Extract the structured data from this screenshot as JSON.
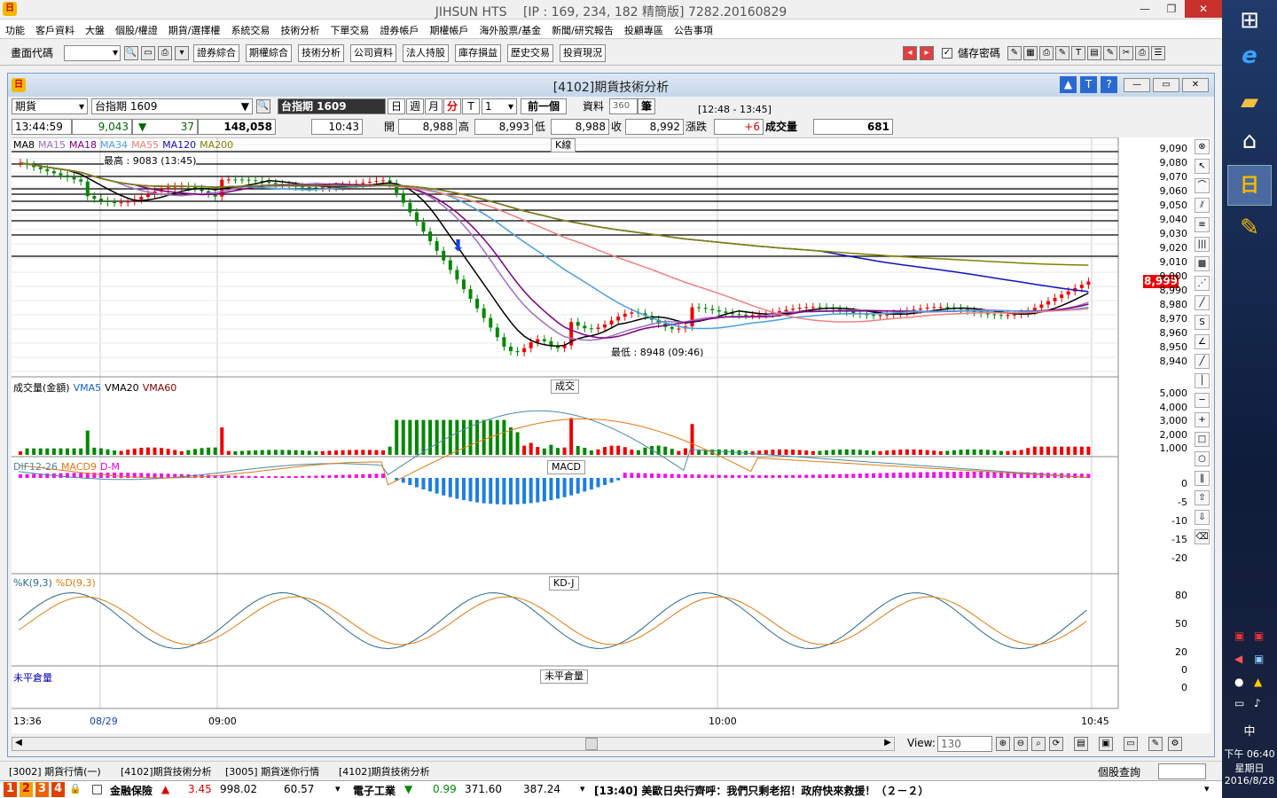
{
  "window": {
    "title": "JIHSUN HTS　 [IP : 169, 234, 182 精簡版] 7282.20160829"
  },
  "menu": [
    "功能",
    "客戶資料",
    "大盤",
    "個股/權證",
    "期貨/選擇權",
    "系統交易",
    "技術分析",
    "下單交易",
    "證券帳戶",
    "期權帳戶",
    "海外股票/基金",
    "新聞/研究報告",
    "投顧專區",
    "公告事項"
  ],
  "toolbar": {
    "code_label": "畫面代碼",
    "buttons": [
      "證券綜合",
      "期權綜合",
      "技術分析",
      "公司資料",
      "法人持股",
      "庫存損益",
      "歷史交易",
      "投資現況"
    ],
    "save_pwd_label": "儲存密碼"
  },
  "child": {
    "title": "[4102]期貨技術分析",
    "product_type": "期貨",
    "product_name": "台指期 1609",
    "symbol_display": "台指期 1609",
    "periods": [
      "日",
      "週",
      "月",
      "分",
      "T"
    ],
    "period_value": "1",
    "prev_btn": "前一個",
    "data_label": "資料",
    "data_count": "360",
    "bars_label": "筆",
    "time_range": "[12:48 - 13:45]",
    "quote": {
      "time": "13:44:59",
      "price": "9,043",
      "change": "37",
      "volume_total": "148,058",
      "bar_time": "10:43",
      "open_label": "開",
      "open": "8,988",
      "high_label": "高",
      "high": "8,993",
      "low_label": "低",
      "low": "8,988",
      "close_label": "收",
      "close": "8,992",
      "chg_label": "漲跌",
      "chg": "+6",
      "vol_label": "成交量",
      "vol": "681"
    }
  },
  "panes": {
    "kline": {
      "title": "K線",
      "legend": [
        {
          "name": "MA8",
          "color": "#000000"
        },
        {
          "name": "MA15",
          "color": "#a070c0"
        },
        {
          "name": "MA18",
          "color": "#800080"
        },
        {
          "name": "MA34",
          "color": "#4aa0e0"
        },
        {
          "name": "MA55",
          "color": "#f08080"
        },
        {
          "name": "MA120",
          "color": "#1010c0"
        },
        {
          "name": "MA200",
          "color": "#808000"
        }
      ],
      "high_note": "最高 : 9083 (13:45)",
      "low_note": "最低 : 8948 (09:46)",
      "yticks": [
        "9,090",
        "9,080",
        "9,070",
        "9,060",
        "9,050",
        "9,040",
        "9,030",
        "9,020",
        "9,010",
        "9,000",
        "8,990",
        "8,980",
        "8,970",
        "8,960",
        "8,950",
        "8,940"
      ],
      "last_price": "8,999"
    },
    "volume": {
      "title": "成交",
      "legend": [
        {
          "name": "成交量(金額)",
          "color": "#000000"
        },
        {
          "name": "VMA5",
          "color": "#1060d0"
        },
        {
          "name": "VMA20",
          "color": "#000000"
        },
        {
          "name": "VMA60",
          "color": "#800000"
        }
      ],
      "yticks": [
        "5,000",
        "4,000",
        "3,000",
        "2,000",
        "1,000"
      ]
    },
    "macd": {
      "title": "MACD",
      "legend": [
        {
          "name": "DIF12-26",
          "color": "#4a8aa8"
        },
        {
          "name": "MACD9",
          "color": "#e07a10"
        },
        {
          "name": "D-M",
          "color": "#e000e0"
        }
      ],
      "yticks": [
        "0",
        "-5",
        "-10",
        "-15",
        "-20"
      ]
    },
    "kd": {
      "title": "KD-J",
      "legend": [
        {
          "name": "%K(9,3)",
          "color": "#2a6a8a"
        },
        {
          "name": "%D(9,3)",
          "color": "#e07a10"
        }
      ],
      "yticks": [
        "80",
        "50",
        "20"
      ]
    },
    "oi": {
      "title": "未平倉量",
      "legend": [
        {
          "name": "未平倉量",
          "color": "#0000c0"
        }
      ],
      "yticks": [
        "0",
        "0"
      ]
    },
    "xticks": [
      {
        "label": "13:36",
        "color": "#000"
      },
      {
        "label": "08/29",
        "color": "#1040c0"
      },
      {
        "label": "09:00",
        "color": "#000"
      },
      {
        "label": "10:00",
        "color": "#000"
      },
      {
        "label": "10:45",
        "color": "#000"
      }
    ]
  },
  "scroll": {
    "view_label": "View:",
    "view_value": "130"
  },
  "tabs": [
    "[3002] 期貨行情(一)",
    "[4102]期貨技術分析",
    "[3005] 期貨迷你行情",
    "[4102]期貨技術分析"
  ],
  "stock_query_label": "個股查詢",
  "status": {
    "pages": [
      "1",
      "2",
      "3",
      "4"
    ],
    "index1_name": "金融保險",
    "index1_chg": "3.45",
    "index1_val": "998.02",
    "index1_extra": "60.57",
    "index2_name": "電子工業",
    "index2_chg": "0.99",
    "index2_val": "371.60",
    "index2_extra": "387.24",
    "news": "[13:40] 美歐日央行齊呼：我們只剩老招！政府快來救援！（２－２）"
  },
  "win_taskbar": {
    "ime": "中",
    "time": "下午 06:40",
    "weekday": "星期日",
    "date": "2016/8/28"
  },
  "chart_data": {
    "type": "candlestick",
    "title": "K線",
    "xlabels": [
      "13:36",
      "08/29",
      "09:00",
      "10:00",
      "10:45"
    ],
    "ylim": [
      8940,
      9090
    ],
    "high": 9083,
    "low": 8948,
    "last": 8999,
    "ma_series_names": [
      "MA8",
      "MA15",
      "MA18",
      "MA34",
      "MA55",
      "MA120",
      "MA200"
    ]
  }
}
